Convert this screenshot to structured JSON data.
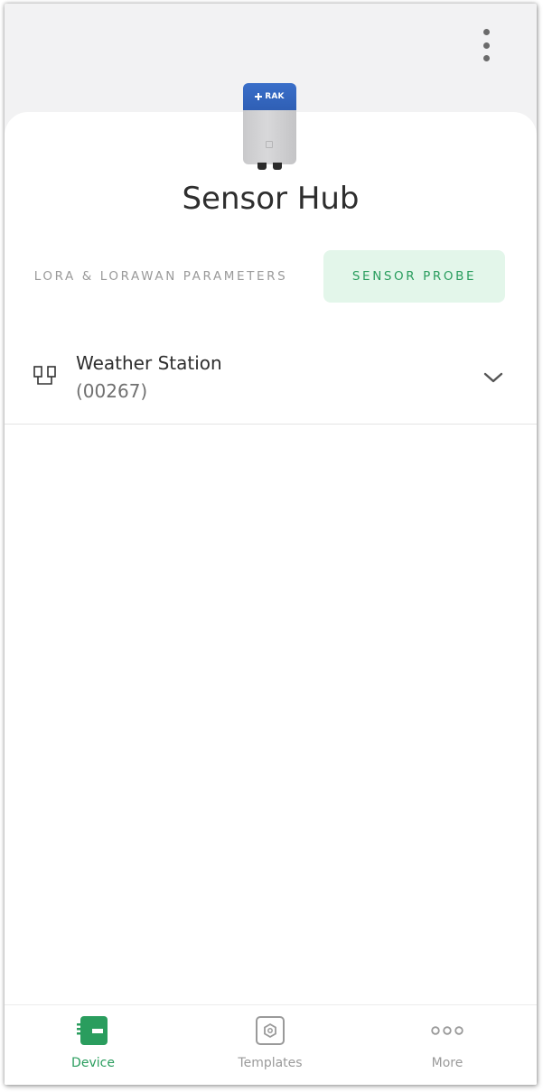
{
  "header": {
    "menu_icon": "more-vertical-icon"
  },
  "device": {
    "brand_label": "RAK",
    "name": "Sensor Hub"
  },
  "tabs": [
    {
      "label": "LORA & LORAWAN PARAMETERS",
      "active": false
    },
    {
      "label": "SENSOR PROBE",
      "active": true
    }
  ],
  "probe": {
    "icon": "sensor-probe-icon",
    "name": "Weather Station",
    "id": "(00267)",
    "expand_icon": "chevron-down-icon"
  },
  "bottom_nav": [
    {
      "label": "Device",
      "icon": "device-icon",
      "active": true
    },
    {
      "label": "Templates",
      "icon": "templates-icon",
      "active": false
    },
    {
      "label": "More",
      "icon": "more-horizontal-icon",
      "active": false
    }
  ],
  "colors": {
    "accent": "#2a9d5e",
    "accent_bg": "#e3f6ea",
    "header_bg": "#f2f2f3",
    "device_blue": "#2f5fb5"
  }
}
